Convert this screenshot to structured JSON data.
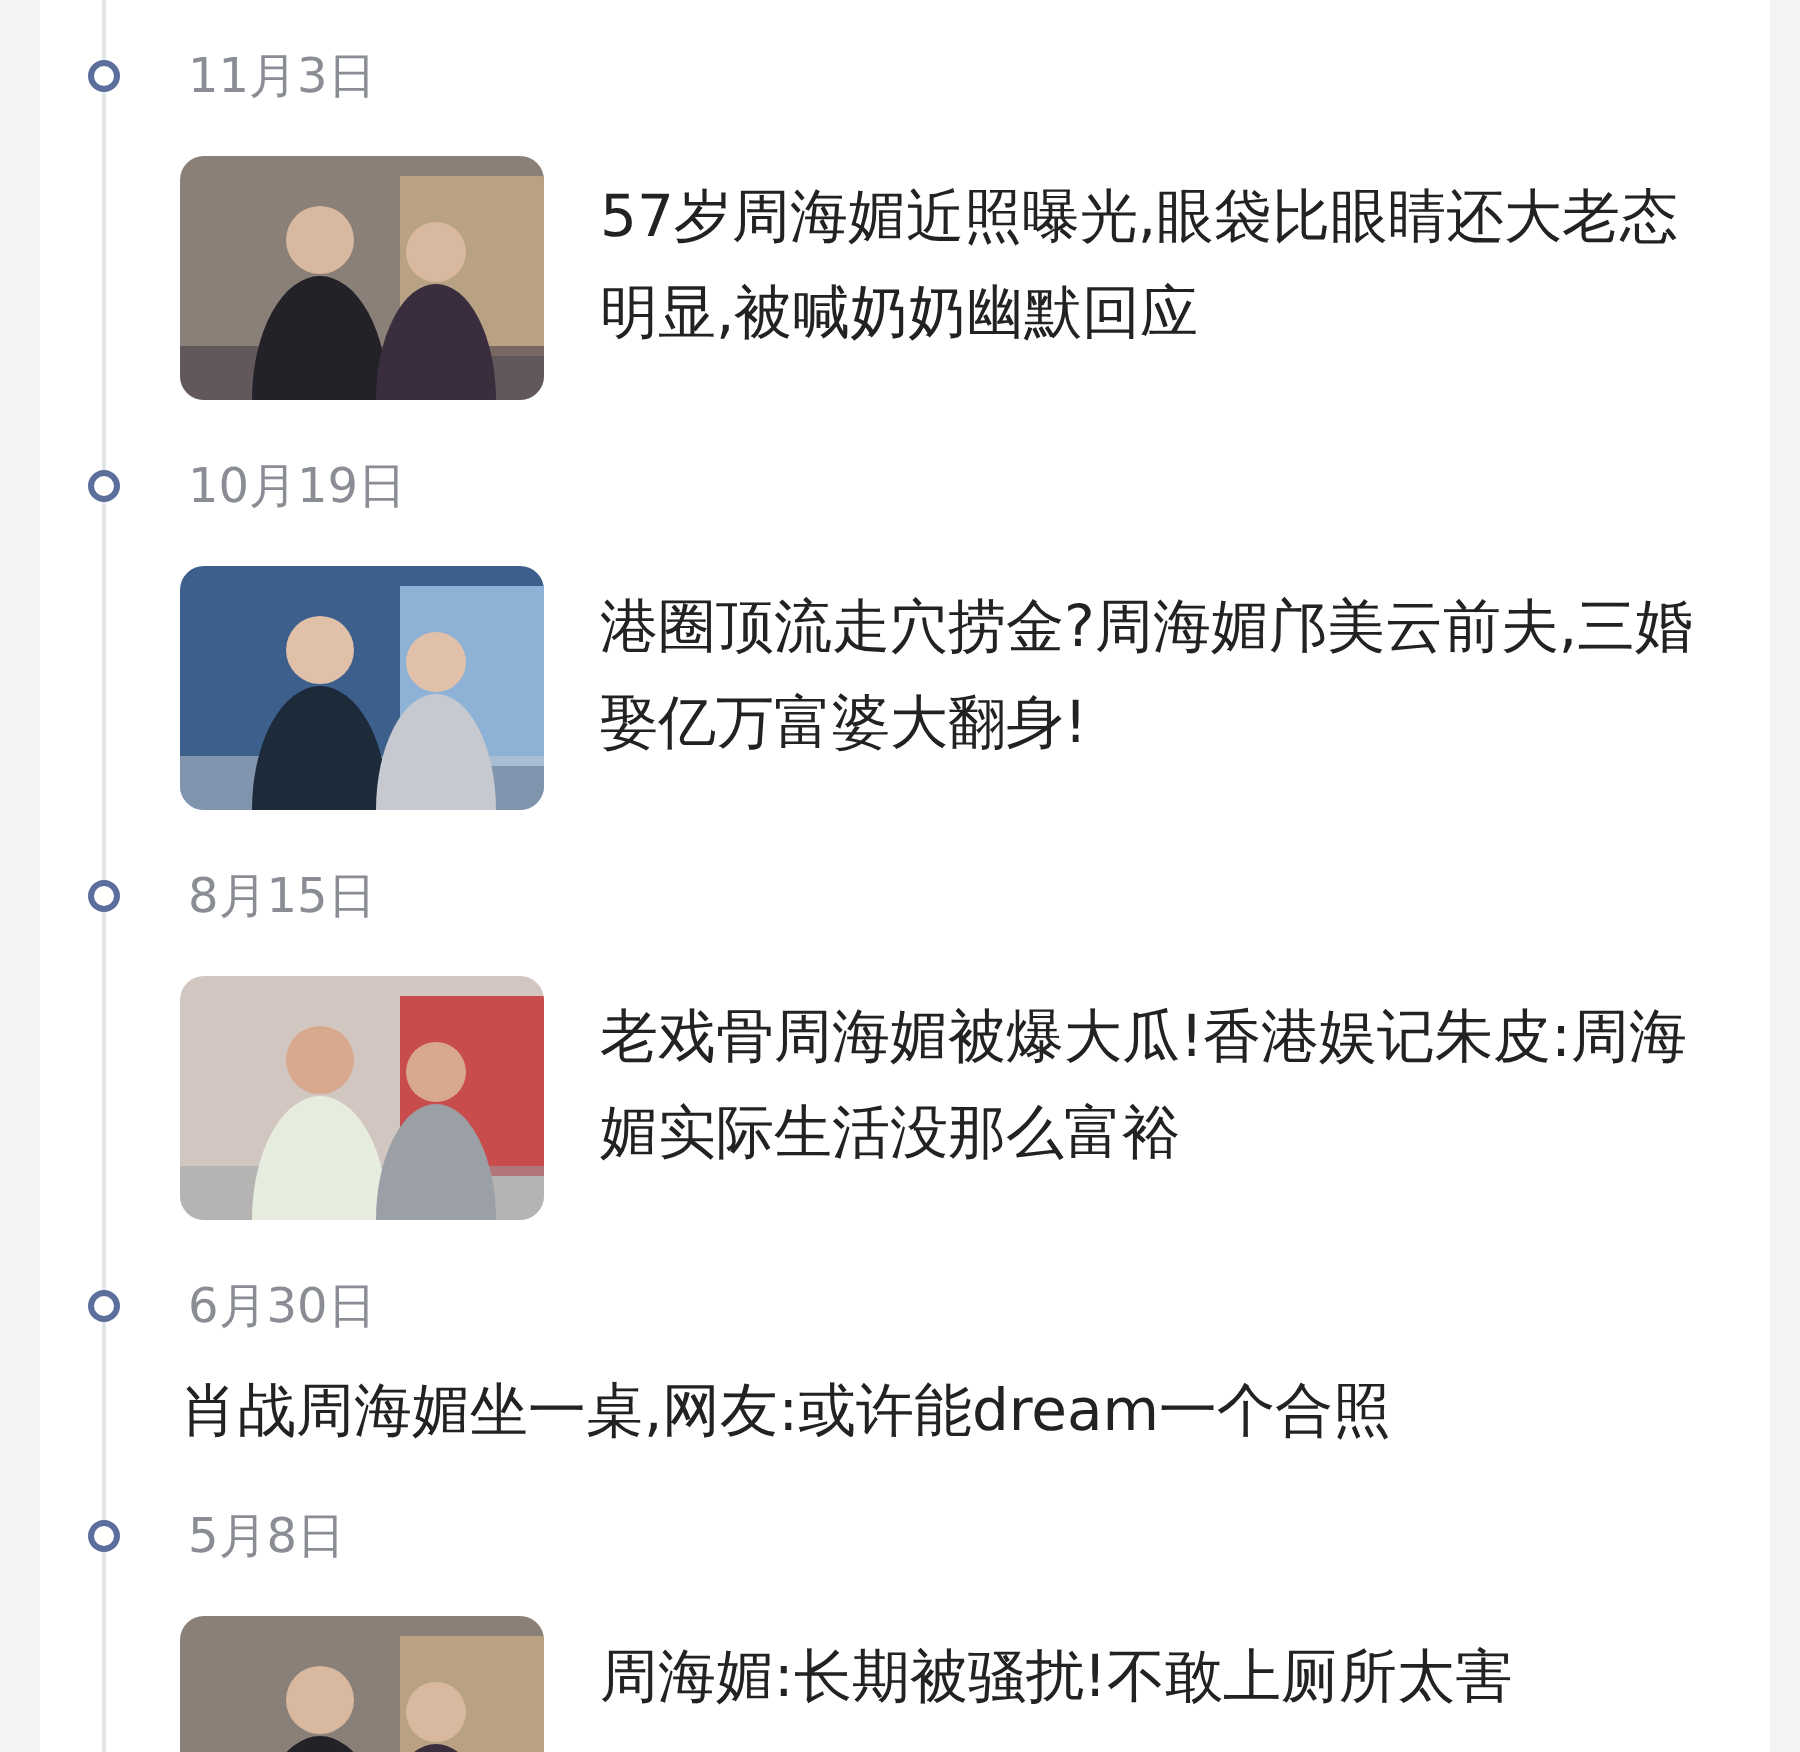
{
  "timeline": [
    {
      "date": "11月3日",
      "kind": "with_picture",
      "title": "57岁周海媚近照曝光,眼袋比眼睛还大老态明显,被喊奶奶幽默回应"
    },
    {
      "date": "10月19日",
      "kind": "with_picture",
      "title": "港圈顶流走穴捞金?周海媚邝美云前夫,三婚娶亿万富婆大翻身!"
    },
    {
      "date": "8月15日",
      "kind": "with_picture",
      "title": "老戏骨周海媚被爆大瓜!香港娱记朱皮:周海媚实际生活没那么富裕"
    },
    {
      "date": "6月30日",
      "kind": "text_only",
      "title": "肖战周海媚坐一桌,网友:或许能dream一个合照"
    },
    {
      "date": "5月8日",
      "kind": "with_picture",
      "title": "周海媚:长期被骚扰!不敢上厕所太害"
    }
  ]
}
